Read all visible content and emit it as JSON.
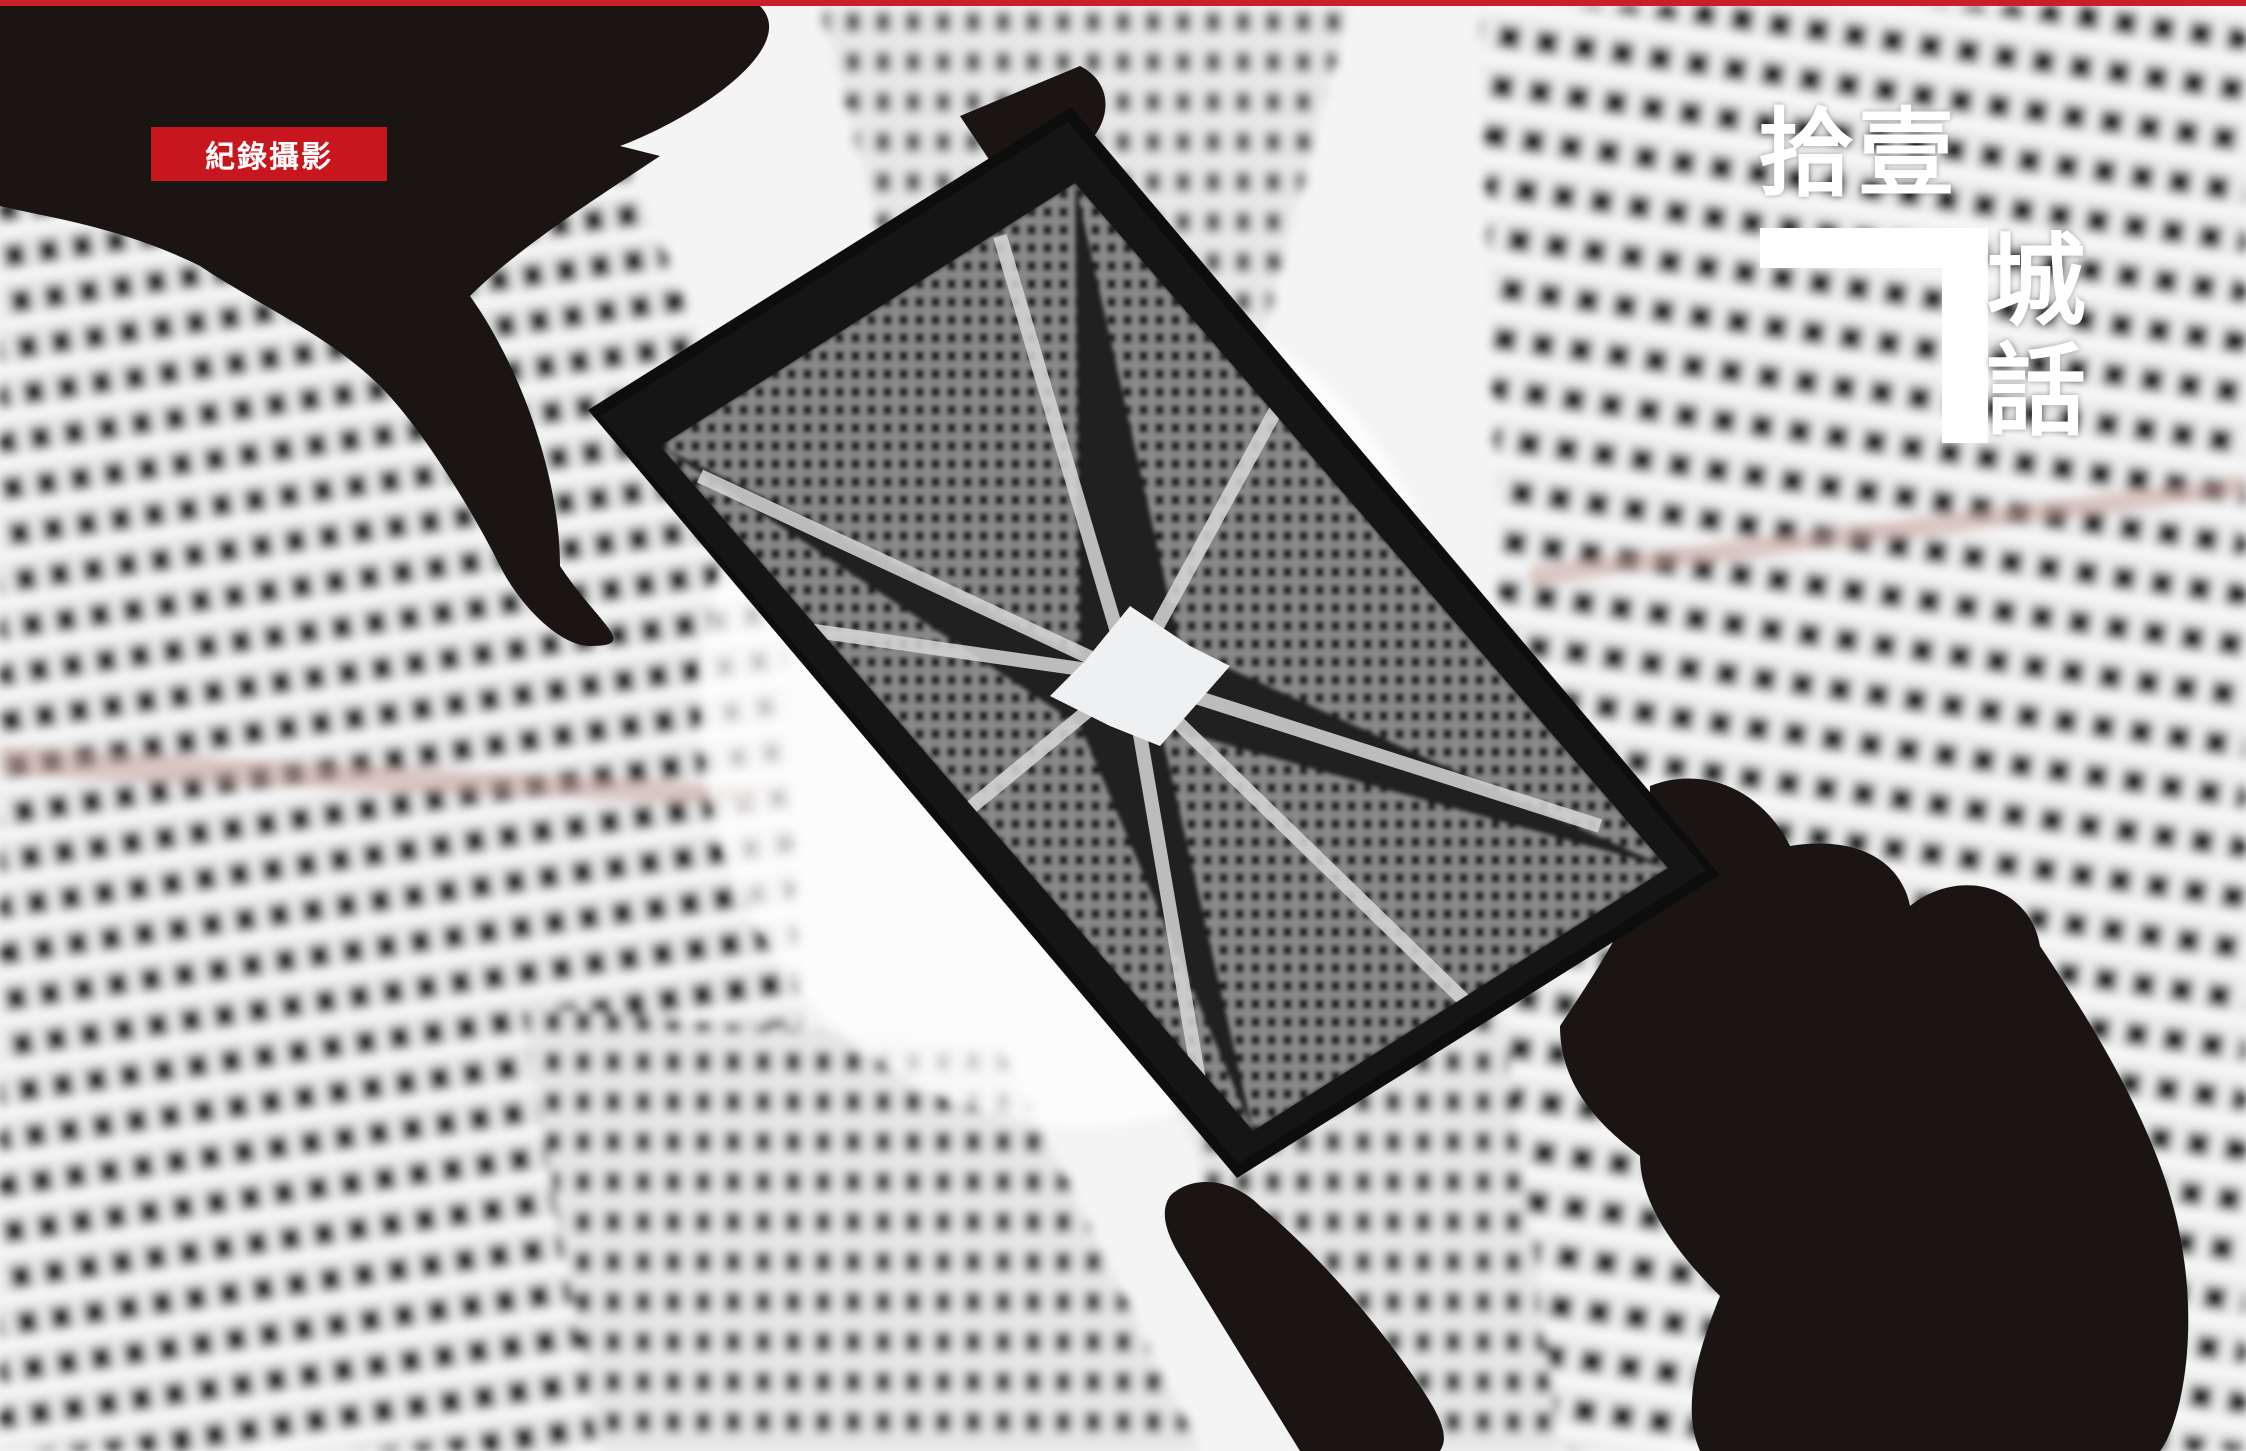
{
  "section_tag": "紀錄攝影",
  "title": {
    "line1": "拾壹",
    "numeral": "7",
    "line2_char1": "城",
    "line2_char2": "話"
  },
  "colors": {
    "accent_red": "#c8161e",
    "title_white": "#ffffff"
  },
  "photo": {
    "icon": "photo-of-hands-holding-phone-showing-upward-view-of-tower-blocks"
  }
}
